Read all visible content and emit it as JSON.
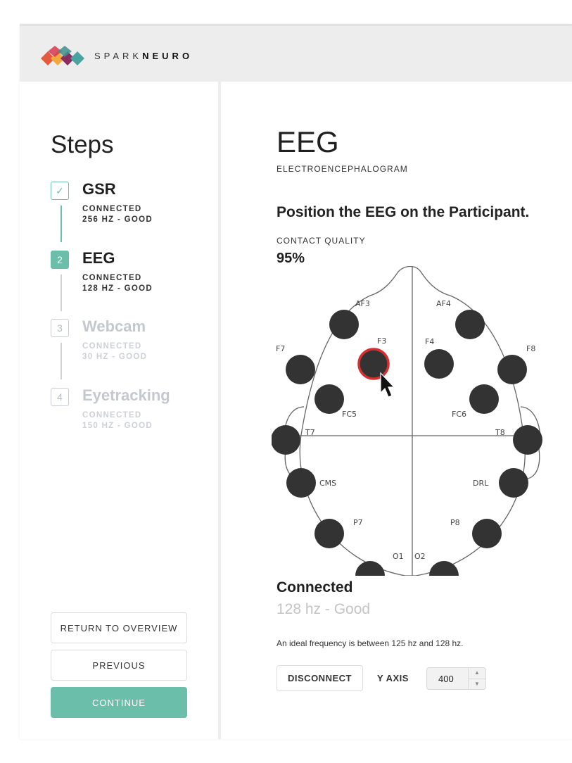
{
  "brand": {
    "light": "SPARK",
    "bold": "NEURO"
  },
  "steps": {
    "title": "Steps",
    "items": [
      {
        "marker": "✓",
        "name": "GSR",
        "line1": "CONNECTED",
        "line2": "256 HZ - GOOD"
      },
      {
        "marker": "2",
        "name": "EEG",
        "line1": "CONNECTED",
        "line2": "128 HZ - GOOD"
      },
      {
        "marker": "3",
        "name": "Webcam",
        "line1": "CONNECTED",
        "line2": "30 HZ - GOOD"
      },
      {
        "marker": "4",
        "name": "Eyetracking",
        "line1": "CONNECTED",
        "line2": "150 HZ - GOOD"
      }
    ]
  },
  "buttons": {
    "overview": "RETURN TO OVERVIEW",
    "previous": "PREVIOUS",
    "continue": "CONTINUE"
  },
  "main": {
    "title": "EEG",
    "subtitle": "ELECTROENCEPHALOGRAM",
    "instruction": "Position the EEG on the Participant.",
    "contact_label": "CONTACT QUALITY",
    "contact_value": "95%",
    "status": "Connected",
    "rate": "128 hz - Good",
    "hint": "An ideal frequency is between 125 hz and 128 hz.",
    "disconnect": "DISCONNECT",
    "yaxis_label": "Y AXIS",
    "yaxis_value": "400"
  },
  "electrodes": [
    {
      "label": "AF3"
    },
    {
      "label": "AF4"
    },
    {
      "label": "F3"
    },
    {
      "label": "F4"
    },
    {
      "label": "F7"
    },
    {
      "label": "F8"
    },
    {
      "label": "FC5"
    },
    {
      "label": "FC6"
    },
    {
      "label": "T7"
    },
    {
      "label": "T8"
    },
    {
      "label": "CMS"
    },
    {
      "label": "DRL"
    },
    {
      "label": "P7"
    },
    {
      "label": "P8"
    },
    {
      "label": "O1"
    },
    {
      "label": "O2"
    }
  ],
  "colors": {
    "accent": "#6bbfaa",
    "electrode": "#333333",
    "highlight": "#d62f2f"
  }
}
